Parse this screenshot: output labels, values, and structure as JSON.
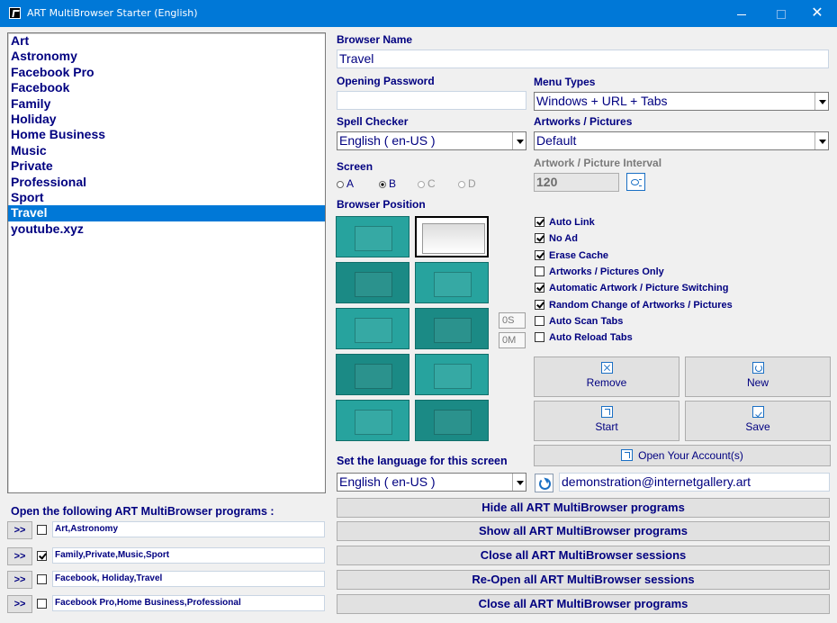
{
  "window": {
    "title": "ART MultiBrowser Starter (English)",
    "min_glyph": "",
    "max_glyph": "",
    "close_glyph": "✕"
  },
  "browser_list": {
    "items": [
      "Art",
      "Astronomy",
      "Facebook Pro",
      "Facebook",
      "Family",
      "Holiday",
      "Home Business",
      "Music",
      "Private",
      "Professional",
      "Sport",
      "Travel",
      "youtube.xyz"
    ],
    "selected": "Travel"
  },
  "form": {
    "browser_name_label": "Browser Name",
    "browser_name_value": "Travel",
    "opening_password_label": "Opening Password",
    "opening_password_value": "",
    "menu_types_label": "Menu Types",
    "menu_types_value": "Windows + URL + Tabs",
    "spell_checker_label": "Spell Checker",
    "spell_checker_value": "English ( en-US )",
    "artworks_label": "Artworks / Pictures",
    "artworks_value": "Default",
    "screen_label": "Screen",
    "screens": [
      {
        "label": "A",
        "state": "enabled"
      },
      {
        "label": "B",
        "state": "selected"
      },
      {
        "label": "C",
        "state": "disabled"
      },
      {
        "label": "D",
        "state": "disabled"
      }
    ],
    "interval_label": "Artwork / Picture Interval",
    "interval_value": "120",
    "browser_position_label": "Browser Position",
    "position_selected": 2,
    "seconds_value": "0S",
    "minutes_value": "0M"
  },
  "options": [
    {
      "label": "Auto Link",
      "checked": true
    },
    {
      "label": "No Ad",
      "checked": true
    },
    {
      "label": "Erase Cache",
      "checked": true
    },
    {
      "label": "Artworks / Pictures Only",
      "checked": false
    },
    {
      "label": "Automatic Artwork / Picture Switching",
      "checked": true
    },
    {
      "label": "Random Change of Artworks / Pictures",
      "checked": true
    },
    {
      "label": "Auto Scan Tabs",
      "checked": false
    },
    {
      "label": "Auto Reload Tabs",
      "checked": false
    }
  ],
  "actions": {
    "remove": "Remove",
    "new": "New",
    "start": "Start",
    "save": "Save",
    "open_account": "Open Your Account(s)"
  },
  "language": {
    "label": "Set the language for this screen",
    "value": "English ( en-US )",
    "email": "demonstration@internetgallery.art"
  },
  "programs": {
    "label": "Open the following ART MultiBrowser programs :",
    "arrow_label": ">>",
    "rows": [
      {
        "checked": false,
        "value": "Art,Astronomy"
      },
      {
        "checked": true,
        "value": "Family,Private,Music,Sport"
      },
      {
        "checked": false,
        "value": "Facebook, Holiday,Travel"
      },
      {
        "checked": false,
        "value": "Facebook Pro,Home Business,Professional"
      }
    ]
  },
  "bottom_buttons": {
    "hide_all": "Hide all ART MultiBrowser programs",
    "show_all": "Show all ART MultiBrowser programs",
    "close_sessions": "Close all ART MultiBrowser sessions",
    "reopen_sessions": "Re-Open all ART MultiBrowser sessions",
    "close_programs": "Close all ART MultiBrowser programs"
  },
  "colors": {
    "title_bar": "#0078d7",
    "label_text": "#000080",
    "selection": "#0078d7",
    "tile": "#27a39e"
  }
}
